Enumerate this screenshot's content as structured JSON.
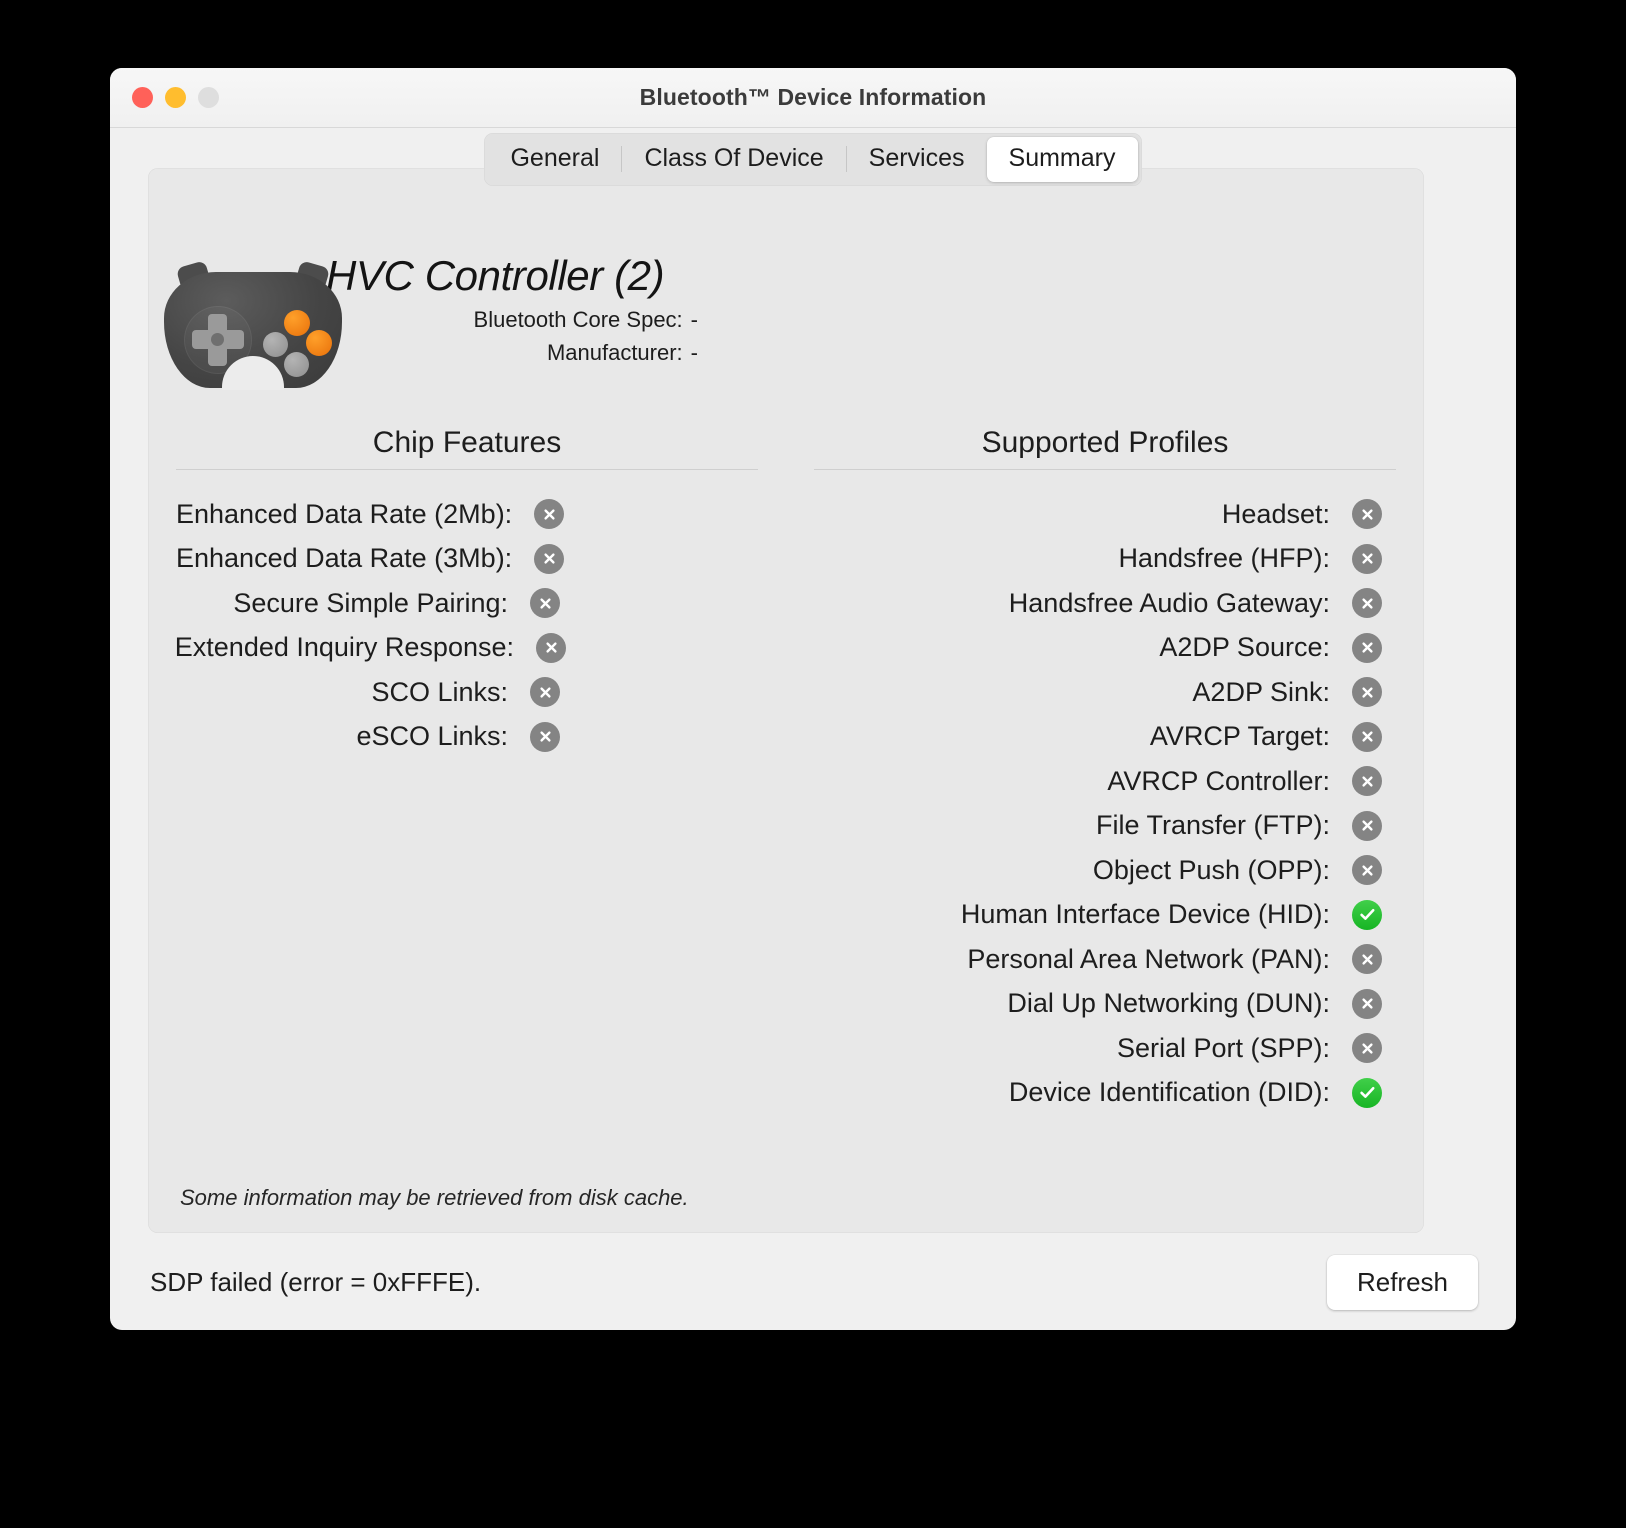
{
  "window": {
    "title": "Bluetooth™ Device Information",
    "traffic_lights": [
      {
        "name": "close",
        "color": "#ff6159"
      },
      {
        "name": "minimize",
        "color": "#ffbd2e"
      },
      {
        "name": "zoom",
        "color": "#dedede"
      }
    ]
  },
  "tabs": [
    {
      "label": "General",
      "active": false
    },
    {
      "label": "Class Of Device",
      "active": false
    },
    {
      "label": "Services",
      "active": false
    },
    {
      "label": "Summary",
      "active": true
    }
  ],
  "device": {
    "icon": "gamepad-icon",
    "name": "HVC Controller (2)",
    "core_spec_label": "Bluetooth Core Spec:",
    "core_spec_value": "-",
    "manufacturer_label": "Manufacturer:",
    "manufacturer_value": "-"
  },
  "chip_features": {
    "heading": "Chip Features",
    "rows": [
      {
        "label": "Enhanced Data Rate (2Mb):",
        "supported": false
      },
      {
        "label": "Enhanced Data Rate (3Mb):",
        "supported": false
      },
      {
        "label": "Secure Simple Pairing:",
        "supported": false
      },
      {
        "label": "Extended Inquiry Response:",
        "supported": false
      },
      {
        "label": "SCO Links:",
        "supported": false
      },
      {
        "label": "eSCO Links:",
        "supported": false
      }
    ]
  },
  "supported_profiles": {
    "heading": "Supported Profiles",
    "rows": [
      {
        "label": "Headset:",
        "supported": false
      },
      {
        "label": "Handsfree (HFP):",
        "supported": false
      },
      {
        "label": "Handsfree Audio Gateway:",
        "supported": false
      },
      {
        "label": "A2DP Source:",
        "supported": false
      },
      {
        "label": "A2DP Sink:",
        "supported": false
      },
      {
        "label": "AVRCP Target:",
        "supported": false
      },
      {
        "label": "AVRCP Controller:",
        "supported": false
      },
      {
        "label": "File Transfer (FTP):",
        "supported": false
      },
      {
        "label": "Object Push (OPP):",
        "supported": false
      },
      {
        "label": "Human Interface Device (HID):",
        "supported": true
      },
      {
        "label": "Personal Area Network (PAN):",
        "supported": false
      },
      {
        "label": "Dial Up Networking (DUN):",
        "supported": false
      },
      {
        "label": "Serial Port (SPP):",
        "supported": false
      },
      {
        "label": "Device Identification (DID):",
        "supported": true
      }
    ]
  },
  "disclaimer": "Some information may be retrieved from disk cache.",
  "footer": {
    "status_message": "SDP failed (error = 0xFFFE).",
    "refresh_label": "Refresh"
  },
  "colors": {
    "supported": "#17b524",
    "unsupported": "#848484",
    "window_bg": "#f0f0f0",
    "panel_bg": "#e8e8e8"
  }
}
